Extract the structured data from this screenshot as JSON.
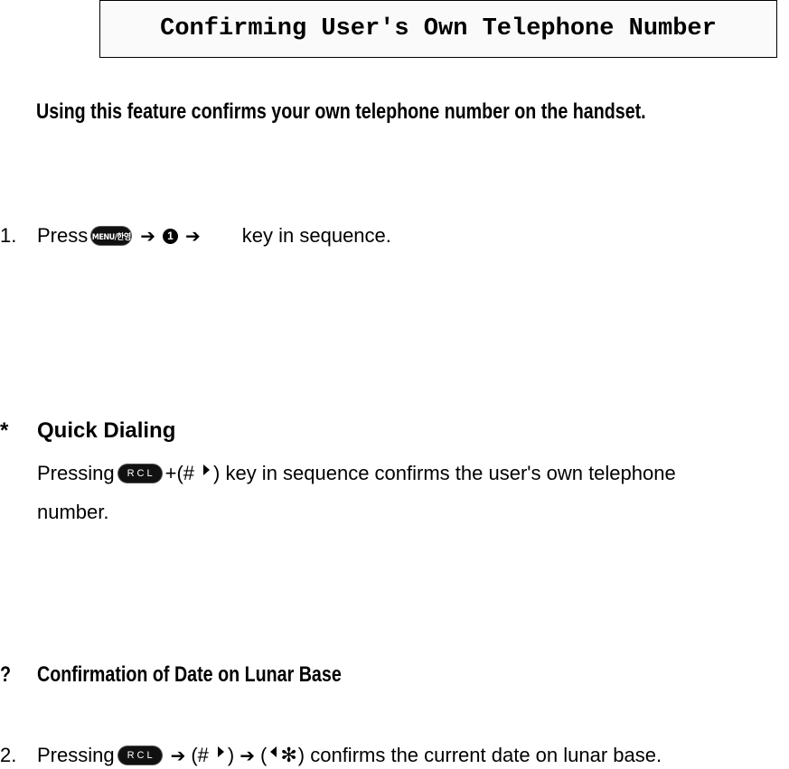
{
  "title": "Confirming User's Own Telephone Number",
  "intro": "Using this feature confirms your own telephone number on the handset.",
  "step1": {
    "number": "1.",
    "press": "Press",
    "menu_key": "MENU/한영",
    "arrow": "➔",
    "key_one": "1",
    "tail": "key in sequence."
  },
  "quick_dialing": {
    "bullet": "*",
    "heading": "Quick Dialing",
    "pressing": "Pressing",
    "rcl_key": "RCL",
    "plus_open": "+(#",
    "close_rest": ") key in sequence confirms the user's own telephone",
    "line2": "number."
  },
  "lunar": {
    "bullet": "?",
    "heading": "Confirmation of Date on Lunar Base"
  },
  "step2": {
    "number": "2.",
    "pressing": "Pressing",
    "rcl_key": "RCL",
    "arrow": "➔",
    "open_hash": "(#",
    "close_paren": ")",
    "open_paren": "(",
    "star": "✻",
    "tail": ") confirms the current date on lunar base."
  }
}
